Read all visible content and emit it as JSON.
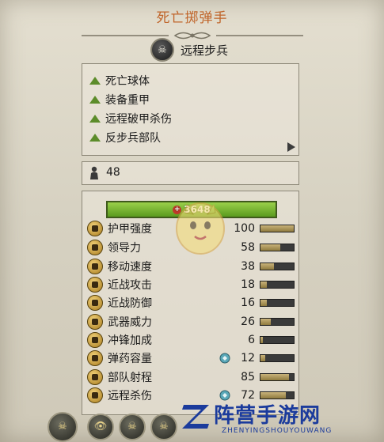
{
  "title": "死亡掷弹手",
  "unit_type": {
    "label": "远程步兵",
    "icon": "skull-icon"
  },
  "abilities": {
    "items": [
      "死亡球体",
      "装备重甲",
      "远程破甲杀伤",
      "反步兵部队"
    ],
    "triangle_color": "#5c8c2a"
  },
  "unit_count": {
    "value": "48",
    "icon": "soldier-icon"
  },
  "health": {
    "value": "3648",
    "color": "#7bb635"
  },
  "stats": [
    {
      "label": "护甲强度",
      "value": "100",
      "icon": "armor-icon",
      "fill": 1.0
    },
    {
      "label": "领导力",
      "value": "58",
      "icon": "leadership-icon",
      "fill": 0.6
    },
    {
      "label": "移动速度",
      "value": "38",
      "icon": "speed-icon",
      "fill": 0.4
    },
    {
      "label": "近战攻击",
      "value": "18",
      "icon": "melee-attack-icon",
      "fill": 0.2
    },
    {
      "label": "近战防御",
      "value": "16",
      "icon": "melee-defense-icon",
      "fill": 0.18
    },
    {
      "label": "武器威力",
      "value": "26",
      "icon": "weapon-strength-icon",
      "fill": 0.3
    },
    {
      "label": "冲锋加成",
      "value": "6",
      "icon": "charge-bonus-icon",
      "fill": 0.08
    },
    {
      "label": "弹药容量",
      "value": "12",
      "icon": "ammo-icon",
      "fill": 0.15,
      "modifier": "bonus-icon"
    },
    {
      "label": "部队射程",
      "value": "85",
      "icon": "range-icon",
      "fill": 0.85
    },
    {
      "label": "远程杀伤",
      "value": "72",
      "icon": "missile-damage-icon",
      "fill": 0.75,
      "modifier": "bonus-icon"
    }
  ],
  "bottom_buttons": [
    "faction-icon",
    "eye-icon",
    "skull-ability-icon",
    "skull-ability-icon-2"
  ],
  "watermark": {
    "text": "阵营手游网",
    "sub": "ZHENYINGSHOUYOUWANG",
    "color": "#1b3b9c"
  }
}
